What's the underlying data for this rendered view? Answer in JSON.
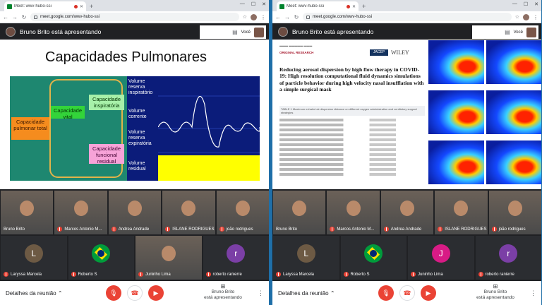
{
  "browser": {
    "tab_title": "Meet: wwv-hubo-ssi",
    "url": "meet.google.com/wwv-hubo-ssi",
    "new_tab": "+"
  },
  "meet": {
    "presenting_header": "Bruno Brito está apresentando",
    "you_label": "Você",
    "details_label": "Detalhes da reunião",
    "presenting_status_line1": "Bruno Brito",
    "presenting_status_line2": "está apresentando"
  },
  "slide_left": {
    "title": "Capacidades Pulmonares",
    "labels": {
      "total": "Capacidade pulmonar total",
      "vital": "Capacidade vital",
      "inspiratory": "Capacidade inspiratória",
      "functional": "Capacidade funcional residual"
    },
    "volumes": {
      "insp_reserve": "Volume reserva inspiratório",
      "tidal": "Volume corrente",
      "exp_reserve": "Volume reserva expiratória",
      "residual": "Volume residual"
    }
  },
  "slide_right": {
    "original_research": "ORIGINAL RESEARCH",
    "journal_badge": "JACEP",
    "publisher": "WILEY",
    "paper_title": "Reducing aerosol dispersion by high flow therapy in COVID-19: High resolution computational fluid dynamics simulations of particle behavior during high velocity nasal insufflation with a simple surgical mask",
    "table_caption": "TABLE 1 Maximum exhaled air dispersion distance on different oxygen administration and ventilatory support strategies"
  },
  "participants_left": [
    {
      "name": "Bruno Brito",
      "kind": "camera"
    },
    {
      "name": "Marcos Antonio M...",
      "kind": "camera"
    },
    {
      "name": "Andrea Andrade",
      "kind": "camera"
    },
    {
      "name": "ISLANE RODRIGUES",
      "kind": "camera"
    },
    {
      "name": "joão rodrigues",
      "kind": "camera"
    },
    {
      "name": "Laryssa Marcela",
      "kind": "initial",
      "initial": "L",
      "color": "#6d5a44"
    },
    {
      "name": "Roberto S",
      "kind": "flag"
    },
    {
      "name": "Juninho Lima",
      "kind": "camera"
    },
    {
      "name": "roberto ranierre",
      "kind": "initial",
      "initial": "r",
      "color": "#7b3fa6"
    }
  ],
  "participants_right": [
    {
      "name": "Bruno Brito",
      "kind": "camera"
    },
    {
      "name": "Marcos Antonio M...",
      "kind": "camera"
    },
    {
      "name": "Andrea Andrade",
      "kind": "camera"
    },
    {
      "name": "ISLANE RODRIGUES",
      "kind": "camera"
    },
    {
      "name": "joão rodrigues",
      "kind": "camera"
    },
    {
      "name": "Laryssa Marcela",
      "kind": "initial",
      "initial": "L",
      "color": "#6d5a44"
    },
    {
      "name": "Roberto S",
      "kind": "flag"
    },
    {
      "name": "Juninho Lima",
      "kind": "initial",
      "initial": "J",
      "color": "#d81b85"
    },
    {
      "name": "roberto ranierre",
      "kind": "initial",
      "initial": "r",
      "color": "#7b3fa6"
    }
  ],
  "colors": {
    "desktop": "#1f6fa8",
    "meet_bg": "#202124",
    "mic_off": "#ea4335"
  }
}
